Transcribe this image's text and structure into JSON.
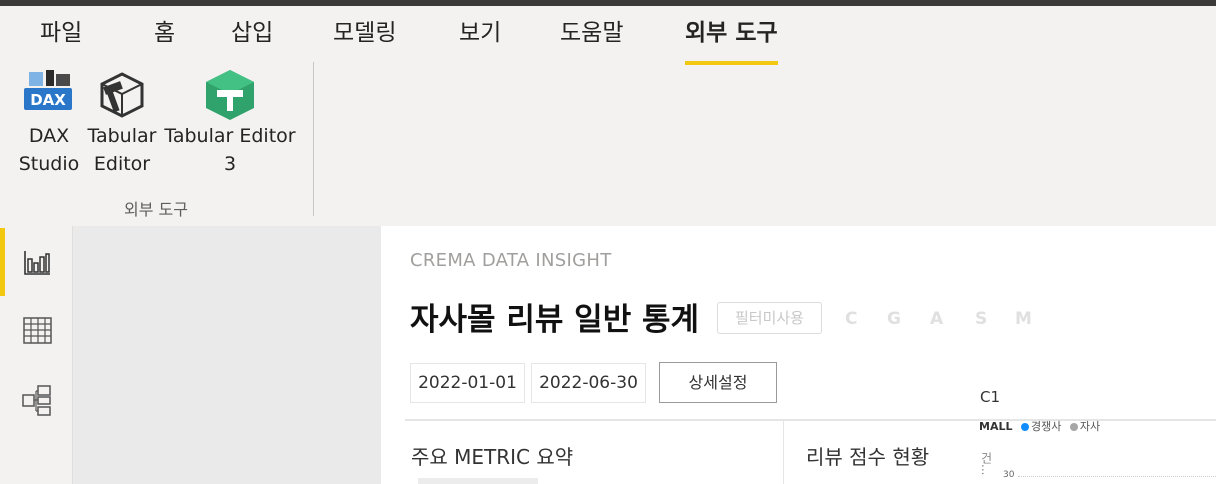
{
  "ribbon": {
    "tabs": [
      {
        "label": "파일"
      },
      {
        "label": "홈"
      },
      {
        "label": "삽입"
      },
      {
        "label": "모델링"
      },
      {
        "label": "보기"
      },
      {
        "label": "도움말"
      },
      {
        "label": "외부 도구",
        "active": true
      }
    ],
    "tools": [
      {
        "label_line1": "DAX",
        "label_line2": "Studio",
        "icon": "dax-studio-icon",
        "icon_text": "DAX"
      },
      {
        "label_line1": "Tabular",
        "label_line2": "Editor",
        "icon": "tabular-editor-icon"
      },
      {
        "label_line1": "Tabular Editor",
        "label_line2": "3",
        "icon": "tabular-editor-3-icon"
      }
    ],
    "group_label": "외부 도구"
  },
  "left_nav": [
    {
      "name": "report-view-icon",
      "active": true
    },
    {
      "name": "data-view-icon",
      "active": false
    },
    {
      "name": "model-view-icon",
      "active": false
    }
  ],
  "report": {
    "brand": "CREMA DATA INSIGHT",
    "title": "자사몰 리뷰 일반 통계",
    "filter_badge": "필터미사용",
    "letters": [
      "C",
      "G",
      "A",
      "S",
      "M"
    ],
    "date_start": "2022-01-01",
    "date_end": "2022-06-30",
    "detail_button": "상세설정",
    "section_metric": "주요 METRIC 요약",
    "section_review": "리뷰 점수 현황",
    "chart": {
      "title": "C1",
      "legend_title": "MALL",
      "legend_items": [
        {
          "label": "경쟁사",
          "color": "#118dff"
        },
        {
          "label": "자사",
          "color": "#a6a6a6"
        }
      ],
      "axis_label_cut": "건...",
      "tick_visible": "30"
    }
  },
  "colors": {
    "accent": "#f2c811",
    "ribbon_bg": "#f3f2f1",
    "canvas_bg": "#eaeaea"
  }
}
